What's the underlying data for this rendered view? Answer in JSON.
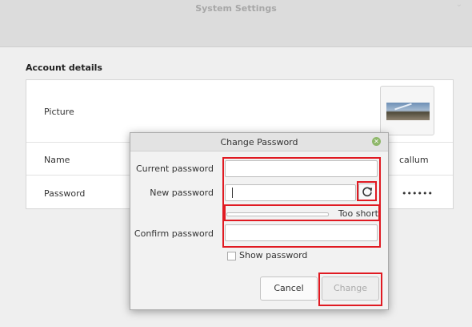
{
  "window": {
    "title": "System Settings"
  },
  "account": {
    "section_title": "Account details",
    "picture_label": "Picture",
    "name_label": "Name",
    "name_value": "callum",
    "password_label": "Password",
    "password_value": "••••••"
  },
  "dialog": {
    "title": "Change Password",
    "current_password_label": "Current password",
    "new_password_label": "New password",
    "confirm_password_label": "Confirm password",
    "current_password_value": "",
    "new_password_value": "",
    "confirm_password_value": "",
    "strength_text": "Too short",
    "strength_level": 0,
    "show_password_label": "Show password",
    "show_password_checked": false,
    "cancel_label": "Cancel",
    "change_label": "Change"
  },
  "colors": {
    "highlight": "#e01a22",
    "close_button": "#8fb86a"
  }
}
